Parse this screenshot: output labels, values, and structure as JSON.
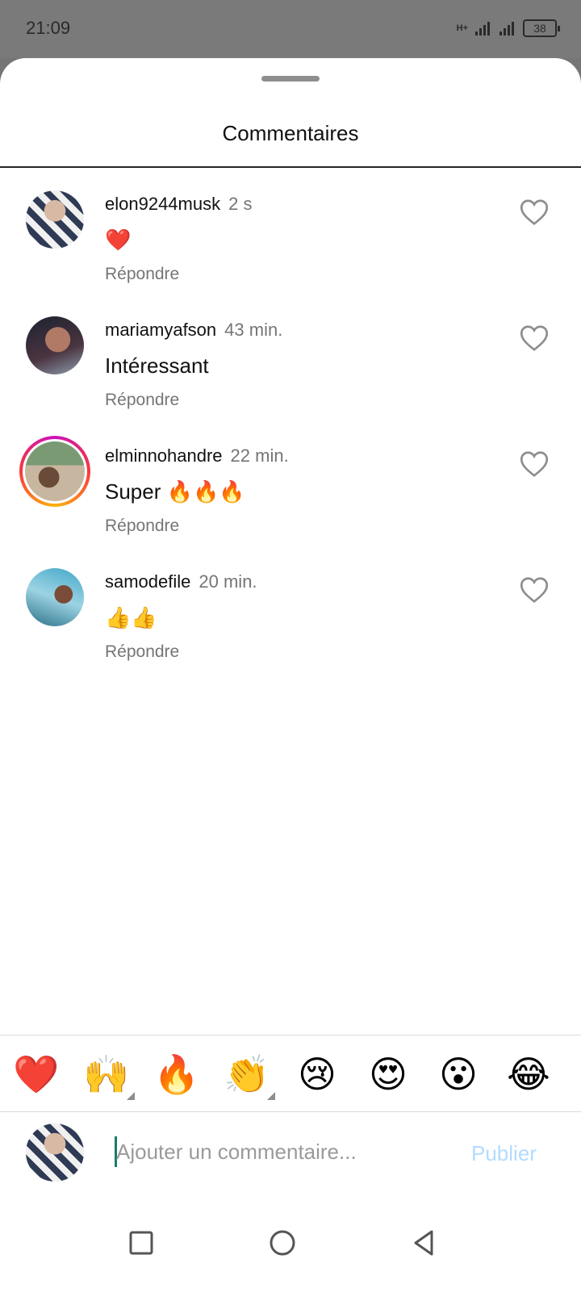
{
  "status_bar": {
    "time": "21:09",
    "network_label": "H+",
    "battery": "38"
  },
  "sheet": {
    "title": "Commentaires"
  },
  "comments": [
    {
      "username": "elon9244musk",
      "time": "2 s",
      "text": "❤️",
      "reply": "Répondre",
      "avatar_story_ring": false
    },
    {
      "username": "mariamyafson",
      "time": "43 min.",
      "text": "Intéressant",
      "reply": "Répondre",
      "avatar_story_ring": false
    },
    {
      "username": "elminnohandre",
      "time": "22 min.",
      "text": "Super 🔥🔥🔥",
      "reply": "Répondre",
      "avatar_story_ring": true
    },
    {
      "username": "samodefile",
      "time": "20 min.",
      "text": "👍👍",
      "reply": "Répondre",
      "avatar_story_ring": false
    }
  ],
  "quick_reactions": [
    "❤️",
    "🙌",
    "🔥",
    "👏",
    "😢",
    "😍",
    "😮",
    "😂"
  ],
  "composer": {
    "placeholder": "Ajouter un commentaire...",
    "value": "",
    "publish_label": "Publier"
  },
  "colors": {
    "accent_disabled": "#b3dbff",
    "secondary_text": "#757575",
    "story_ring": [
      "#c913b9",
      "#f9373f",
      "#feb20b"
    ]
  }
}
